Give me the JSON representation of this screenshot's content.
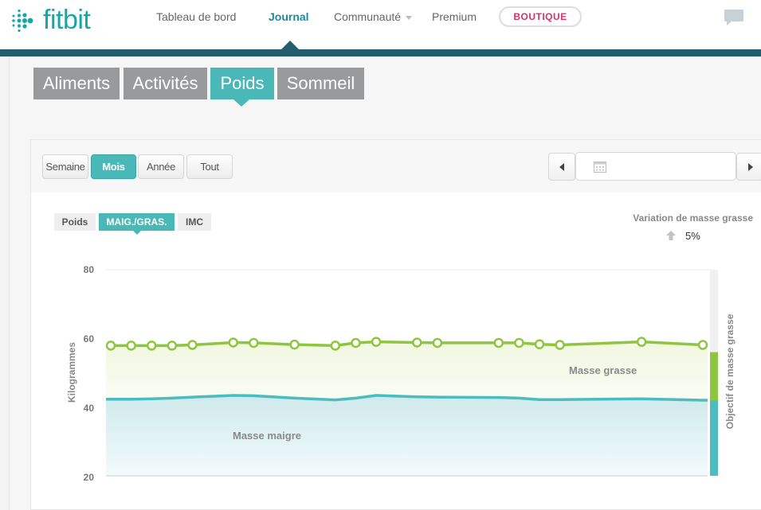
{
  "brand": {
    "name": "fitbit",
    "color": "#13a8ab"
  },
  "nav": {
    "items": [
      {
        "label": "Tableau de bord",
        "active": false
      },
      {
        "label": "Journal",
        "active": true
      },
      {
        "label": "Communauté",
        "active": false,
        "has_dropdown": true
      },
      {
        "label": "Premium",
        "active": false
      }
    ],
    "boutique_label": "BOUTIQUE",
    "chat_icon": "chat-bubble-icon"
  },
  "categories": [
    {
      "label": "Aliments",
      "active": false
    },
    {
      "label": "Activités",
      "active": false
    },
    {
      "label": "Poids",
      "active": true
    },
    {
      "label": "Sommeil",
      "active": false
    }
  ],
  "range": {
    "buttons": [
      {
        "label": "Semaine",
        "active": false
      },
      {
        "label": "Mois",
        "active": true
      },
      {
        "label": "Année",
        "active": false
      },
      {
        "label": "Tout",
        "active": false
      }
    ],
    "date_value": "",
    "prev_icon": "chevron-left-icon",
    "next_icon": "chevron-right-icon",
    "calendar_icon": "calendar-icon"
  },
  "metric_tabs": [
    {
      "label": "Poids",
      "active": false
    },
    {
      "label": "MAIG./GRAS.",
      "active": true
    },
    {
      "label": "IMC",
      "active": false
    }
  ],
  "variation": {
    "title": "Variation de masse grasse",
    "value": "5%",
    "direction_icon": "arrow-up-icon"
  },
  "chart_data": {
    "type": "area",
    "ylabel": "Kilogrammes",
    "y2label": "Objectif de masse grasse",
    "ylim": [
      20,
      80
    ],
    "yticks": [
      "80",
      "60",
      "40",
      "20"
    ],
    "grid": false,
    "colors": {
      "fat": "#8ec63f",
      "lean": "#4bbcc0"
    },
    "area_labels": {
      "fat": "Masse grasse",
      "lean": "Masse maigre"
    },
    "x": [
      1,
      2,
      3,
      4,
      5,
      7,
      8,
      10,
      12,
      13,
      14,
      16,
      17,
      20,
      21,
      22,
      23,
      27,
      30
    ],
    "series": [
      {
        "name": "Masse grasse",
        "values": [
          57.9,
          57.9,
          57.9,
          57.9,
          58.1,
          58.8,
          58.7,
          58.2,
          57.9,
          58.7,
          59.0,
          58.8,
          58.7,
          58.7,
          58.7,
          58.3,
          58.1,
          59.0,
          58.1
        ],
        "markers": true
      },
      {
        "name": "Masse maigre",
        "values": [
          42.3,
          42.3,
          42.4,
          42.6,
          42.9,
          43.4,
          43.3,
          42.6,
          42.1,
          42.6,
          43.4,
          43.0,
          42.9,
          42.8,
          42.6,
          42.2,
          42.2,
          42.4,
          42.0
        ],
        "markers": false
      }
    ],
    "goal": {
      "fat_top": 56.0,
      "lean_top": 42.0,
      "max": 60
    }
  }
}
